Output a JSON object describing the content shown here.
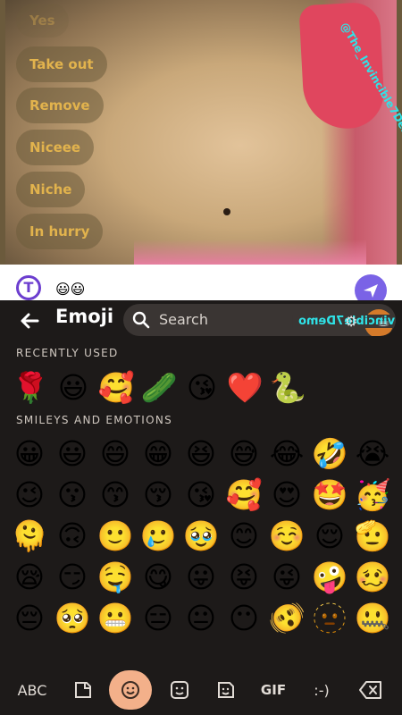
{
  "quick_replies": [
    "Yes",
    "Take out",
    "Remove",
    "Niceee",
    "Niche",
    "In hurry"
  ],
  "watermark": "@The_Invincible7Demo",
  "compose": {
    "text": "😃😃"
  },
  "keyboard": {
    "title": "Emoji",
    "search_placeholder": "Search",
    "recently_used_label": "RECENTLY USED",
    "recent": [
      "🌹",
      "😃",
      "🥰",
      "🥒",
      "😘",
      "❤️",
      "🐍"
    ],
    "section_label": "SMILEYS AND EMOTIONS",
    "grid": [
      [
        "😀",
        "😃",
        "😄",
        "😁",
        "😆",
        "😅",
        "😂",
        "🤣",
        "😭"
      ],
      [
        "😉",
        "😗",
        "😙",
        "😚",
        "😘",
        "🥰",
        "😍",
        "🤩",
        "🥳"
      ],
      [
        "🫠",
        "🙃",
        "🙂",
        "🥲",
        "🥹",
        "😊",
        "☺️",
        "😌",
        "🫡"
      ],
      [
        "😪",
        "😏",
        "🤤",
        "😋",
        "😛",
        "😝",
        "😜",
        "🤪",
        "🥴"
      ],
      [
        "😔",
        "🥺",
        "😬",
        "😑",
        "😐",
        "😶",
        "🫨",
        "🫥",
        "🤐"
      ]
    ]
  },
  "toolbar": {
    "abc": "ABC",
    "gif": "GIF",
    "emoticon": ":-)"
  }
}
